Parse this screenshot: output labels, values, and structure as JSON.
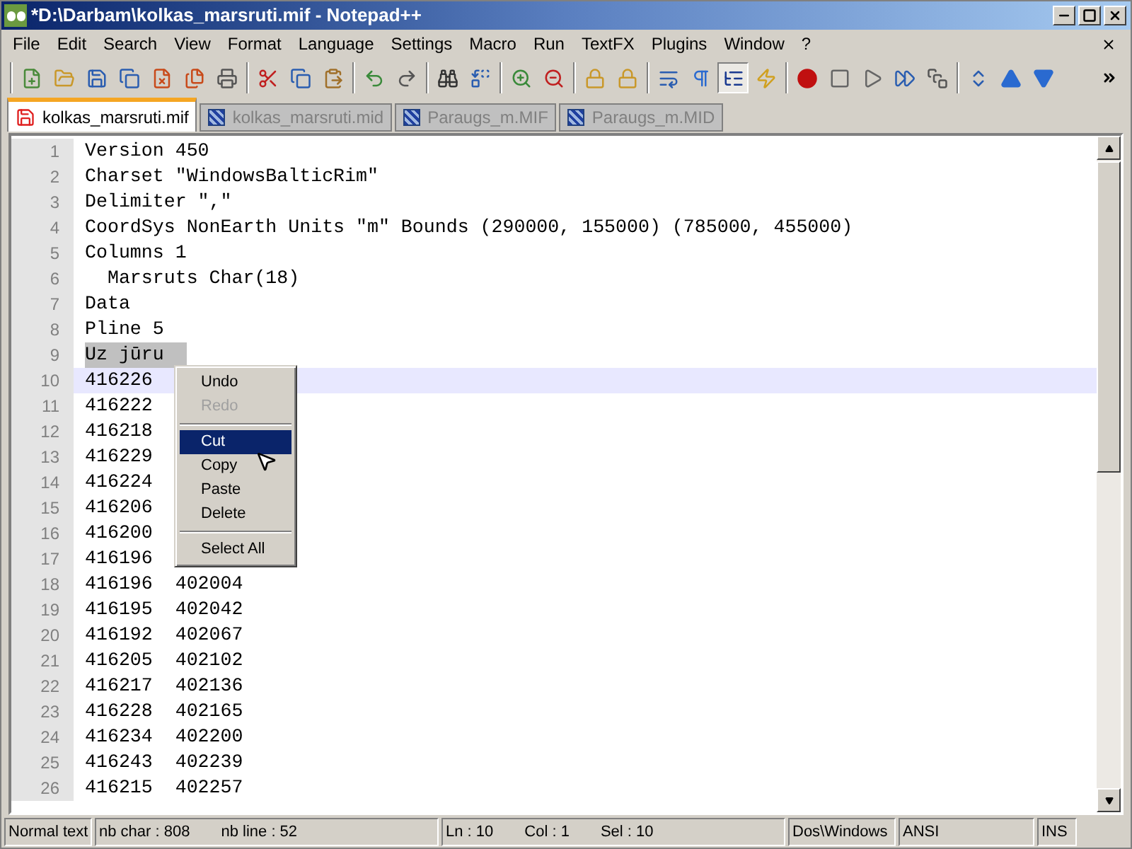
{
  "window": {
    "title": "*D:\\Darbam\\kolkas_marsruti.mif - Notepad++"
  },
  "menu": [
    "File",
    "Edit",
    "Search",
    "View",
    "Format",
    "Language",
    "Settings",
    "Macro",
    "Run",
    "TextFX",
    "Plugins",
    "Window",
    "?"
  ],
  "toolbar": [
    [
      {
        "kind": "new",
        "pressed": false
      },
      {
        "kind": "open",
        "pressed": false
      },
      {
        "kind": "save",
        "pressed": false
      },
      {
        "kind": "saveall",
        "pressed": false
      },
      {
        "kind": "close",
        "pressed": false
      },
      {
        "kind": "closeall",
        "pressed": false
      },
      {
        "kind": "print",
        "pressed": false
      }
    ],
    [
      {
        "kind": "cut",
        "pressed": false
      },
      {
        "kind": "copy",
        "pressed": false
      },
      {
        "kind": "paste",
        "pressed": false
      }
    ],
    [
      {
        "kind": "undo",
        "pressed": false
      },
      {
        "kind": "redo",
        "pressed": false
      }
    ],
    [
      {
        "kind": "find",
        "pressed": false
      },
      {
        "kind": "replace",
        "pressed": false
      }
    ],
    [
      {
        "kind": "zoomin",
        "pressed": false
      },
      {
        "kind": "zoomout",
        "pressed": false
      }
    ],
    [
      {
        "kind": "lock",
        "pressed": false
      },
      {
        "kind": "lock",
        "pressed": false
      }
    ],
    [
      {
        "kind": "wrap",
        "pressed": false
      },
      {
        "kind": "pilcrow",
        "pressed": false
      },
      {
        "kind": "indent",
        "pressed": true
      },
      {
        "kind": "lightning",
        "pressed": false
      }
    ],
    [
      {
        "kind": "record",
        "pressed": false
      },
      {
        "kind": "stop",
        "pressed": false
      },
      {
        "kind": "play",
        "pressed": false
      },
      {
        "kind": "playmulti",
        "pressed": false
      },
      {
        "kind": "savemacro",
        "pressed": false
      }
    ],
    [
      {
        "kind": "sync",
        "pressed": false
      },
      {
        "kind": "up",
        "pressed": false
      },
      {
        "kind": "down",
        "pressed": false
      }
    ]
  ],
  "tabs": [
    {
      "label": "kolkas_marsruti.mif",
      "selected": true,
      "modified": true
    },
    {
      "label": "kolkas_marsruti.mid",
      "selected": false,
      "modified": false
    },
    {
      "label": "Paraugs_m.MIF",
      "selected": false,
      "modified": false
    },
    {
      "label": "Paraugs_m.MID",
      "selected": false,
      "modified": false
    }
  ],
  "editor": {
    "lines": [
      {
        "number": "1",
        "text": "Version 450",
        "current": false,
        "selected": false
      },
      {
        "number": "2",
        "text": "Charset \"WindowsBalticRim\"",
        "current": false,
        "selected": false
      },
      {
        "number": "3",
        "text": "Delimiter \",\"",
        "current": false,
        "selected": false
      },
      {
        "number": "4",
        "text": "CoordSys NonEarth Units \"m\" Bounds (290000, 155000) (785000, 455000)",
        "current": false,
        "selected": false
      },
      {
        "number": "5",
        "text": "Columns 1",
        "current": false,
        "selected": false
      },
      {
        "number": "6",
        "text": "  Marsruts Char(18)",
        "current": false,
        "selected": false
      },
      {
        "number": "7",
        "text": "Data",
        "current": false,
        "selected": false
      },
      {
        "number": "8",
        "text": "Pline 5",
        "current": false,
        "selected": false
      },
      {
        "number": "9",
        "text": "Uz jūru",
        "current": false,
        "selected": true
      },
      {
        "number": "10",
        "text": "416226",
        "current": true,
        "selected": false
      },
      {
        "number": "11",
        "text": "416222",
        "current": false,
        "selected": false
      },
      {
        "number": "12",
        "text": "416218",
        "current": false,
        "selected": false
      },
      {
        "number": "13",
        "text": "416229",
        "current": false,
        "selected": false
      },
      {
        "number": "14",
        "text": "416224",
        "current": false,
        "selected": false
      },
      {
        "number": "15",
        "text": "416206",
        "current": false,
        "selected": false
      },
      {
        "number": "16",
        "text": "416200",
        "current": false,
        "selected": false
      },
      {
        "number": "17",
        "text": "416196",
        "current": false,
        "selected": false
      },
      {
        "number": "18",
        "text": "416196  402004",
        "current": false,
        "selected": false
      },
      {
        "number": "19",
        "text": "416195  402042",
        "current": false,
        "selected": false
      },
      {
        "number": "20",
        "text": "416192  402067",
        "current": false,
        "selected": false
      },
      {
        "number": "21",
        "text": "416205  402102",
        "current": false,
        "selected": false
      },
      {
        "number": "22",
        "text": "416217  402136",
        "current": false,
        "selected": false
      },
      {
        "number": "23",
        "text": "416228  402165",
        "current": false,
        "selected": false
      },
      {
        "number": "24",
        "text": "416234  402200",
        "current": false,
        "selected": false
      },
      {
        "number": "25",
        "text": "416243  402239",
        "current": false,
        "selected": false
      },
      {
        "number": "26",
        "text": "416215  402257",
        "current": false,
        "selected": false
      }
    ]
  },
  "context_menu": [
    {
      "kind": "item",
      "label": "Undo",
      "disabled": false,
      "selected": false
    },
    {
      "kind": "item",
      "label": "Redo",
      "disabled": true,
      "selected": false
    },
    {
      "kind": "separator"
    },
    {
      "kind": "item",
      "label": "Cut",
      "disabled": false,
      "selected": true
    },
    {
      "kind": "item",
      "label": "Copy",
      "disabled": false,
      "selected": false
    },
    {
      "kind": "item",
      "label": "Paste",
      "disabled": false,
      "selected": false
    },
    {
      "kind": "item",
      "label": "Delete",
      "disabled": false,
      "selected": false
    },
    {
      "kind": "separator"
    },
    {
      "kind": "item",
      "label": "Select All",
      "disabled": false,
      "selected": false
    }
  ],
  "status_bar": [
    [
      "Normal text"
    ],
    [
      "nb char : 808",
      "nb line : 52"
    ],
    [
      "Ln : 10",
      "Col : 1",
      "Sel : 10"
    ],
    [
      "Dos\\Windows"
    ],
    [
      "ANSI"
    ],
    [
      "INS"
    ]
  ]
}
